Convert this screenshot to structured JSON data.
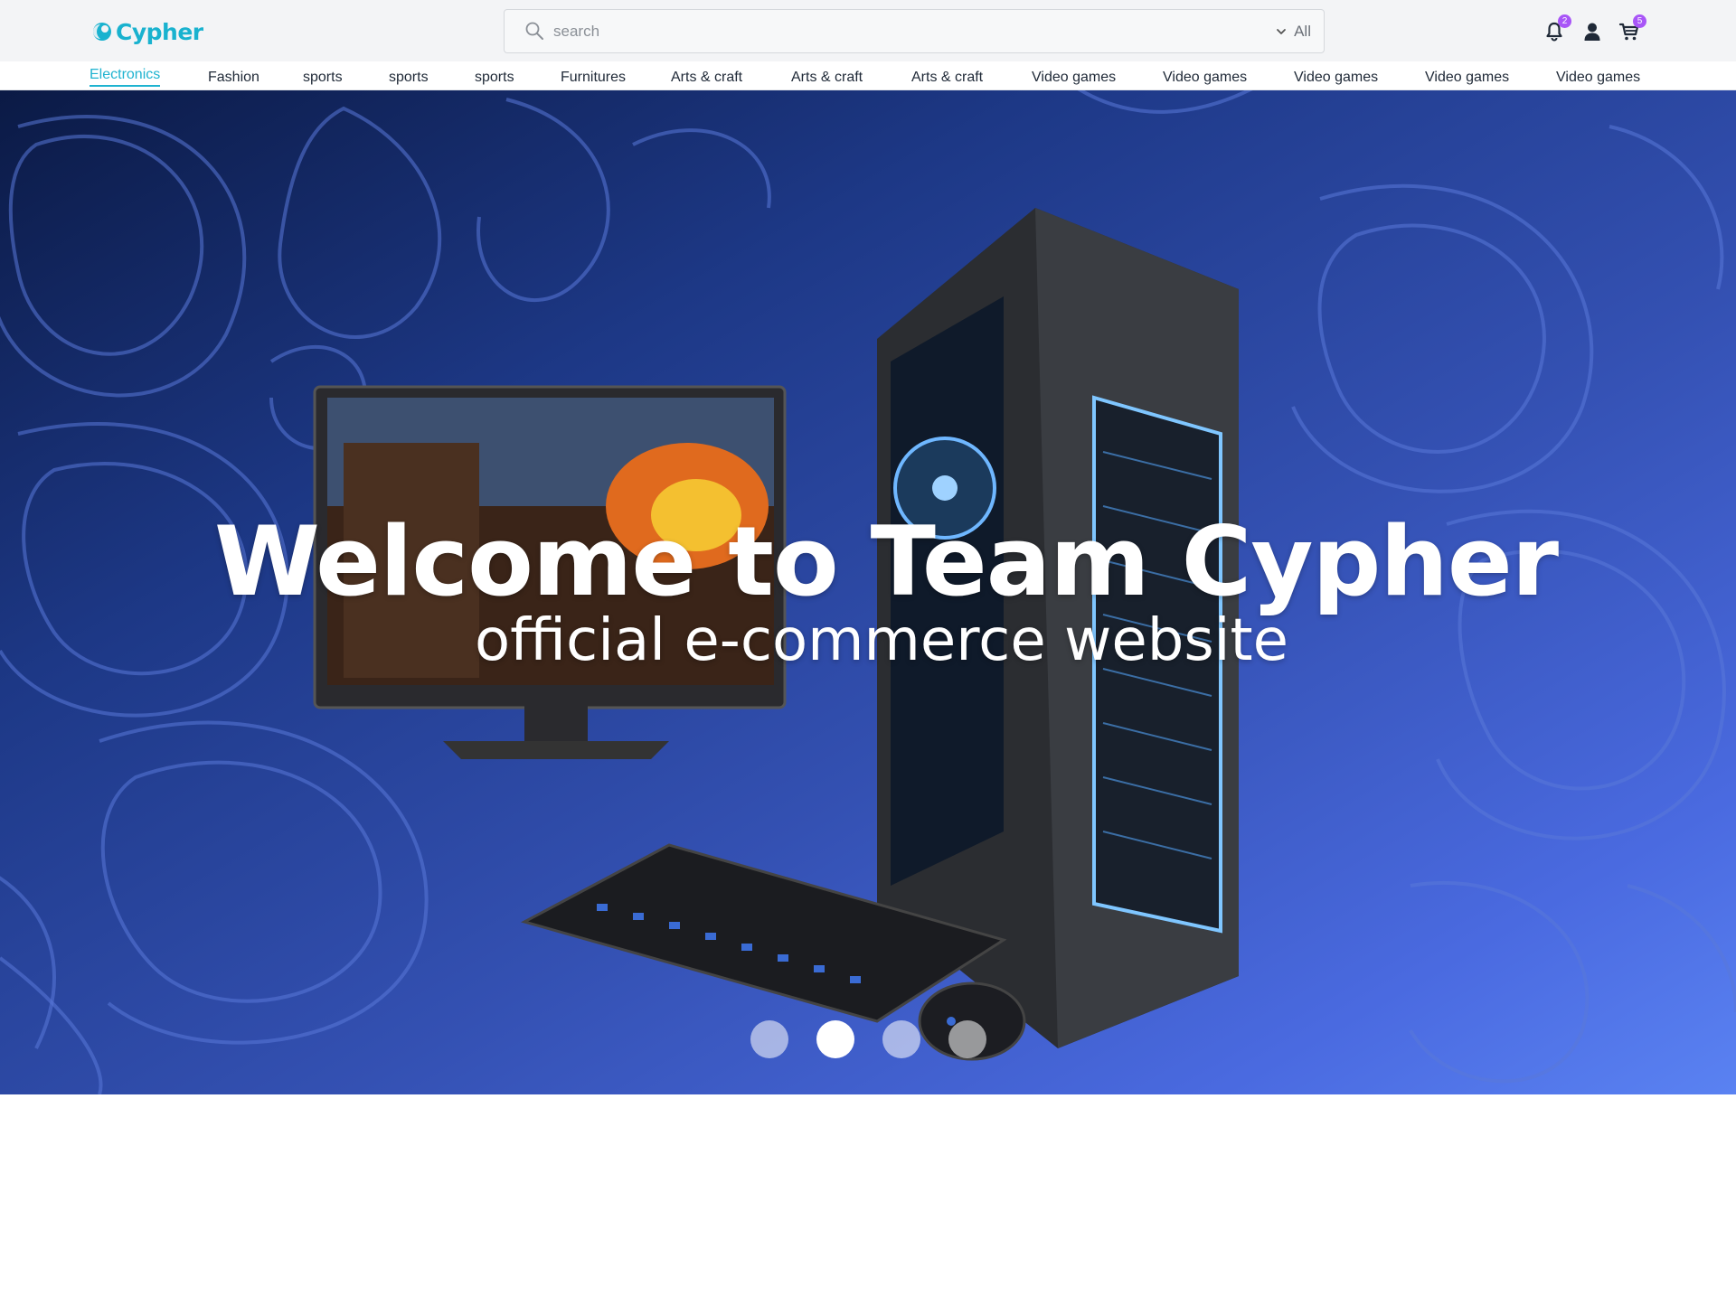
{
  "brand": {
    "name": "Cypher",
    "color": "#19b2cf"
  },
  "search": {
    "placeholder": "search",
    "scope": "All"
  },
  "header_icons": {
    "notifications": {
      "icon": "bell-icon",
      "badge": "2"
    },
    "account": {
      "icon": "user-icon"
    },
    "cart": {
      "icon": "cart-icon",
      "badge": "5"
    }
  },
  "categories": [
    {
      "label": "Electronics",
      "active": true
    },
    {
      "label": "Fashion"
    },
    {
      "label": "sports"
    },
    {
      "label": "sports"
    },
    {
      "label": "sports"
    },
    {
      "label": "Furnitures"
    },
    {
      "label": "Arts & craft"
    },
    {
      "label": "Arts & craft"
    },
    {
      "label": "Arts & craft"
    },
    {
      "label": "Video games"
    },
    {
      "label": "Video games"
    },
    {
      "label": "Video games"
    },
    {
      "label": "Video games"
    },
    {
      "label": "Video games"
    }
  ],
  "hero": {
    "title": "Welcome to Team Cypher",
    "subtitle": "official e-commerce website",
    "slides": 4,
    "active_slide": 2
  },
  "colors": {
    "accent": "#1fb3d0",
    "badge": "#a855f7"
  }
}
